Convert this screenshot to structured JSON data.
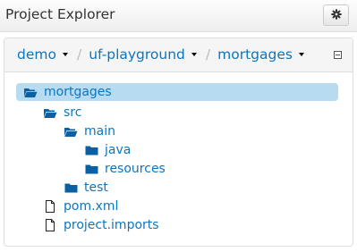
{
  "header": {
    "title": "Project Explorer",
    "settings_icon": "gear-icon"
  },
  "breadcrumb": {
    "items": [
      {
        "label": "demo"
      },
      {
        "label": "uf-playground"
      },
      {
        "label": "mortgages"
      }
    ],
    "separator": "/"
  },
  "tree": {
    "items": [
      {
        "label": "mortgages",
        "icon": "folder-open-icon",
        "selected": true
      },
      {
        "label": "src",
        "icon": "folder-open-icon"
      },
      {
        "label": "main",
        "icon": "folder-open-icon"
      },
      {
        "label": "java",
        "icon": "folder-icon"
      },
      {
        "label": "resources",
        "icon": "folder-icon"
      },
      {
        "label": "test",
        "icon": "folder-icon"
      },
      {
        "label": "pom.xml",
        "icon": "file-icon"
      },
      {
        "label": "project.imports",
        "icon": "file-icon"
      }
    ]
  },
  "colors": {
    "link": "#0b76c0",
    "selected_bg": "#b7dcf2",
    "icon": "#0b5fa3"
  }
}
